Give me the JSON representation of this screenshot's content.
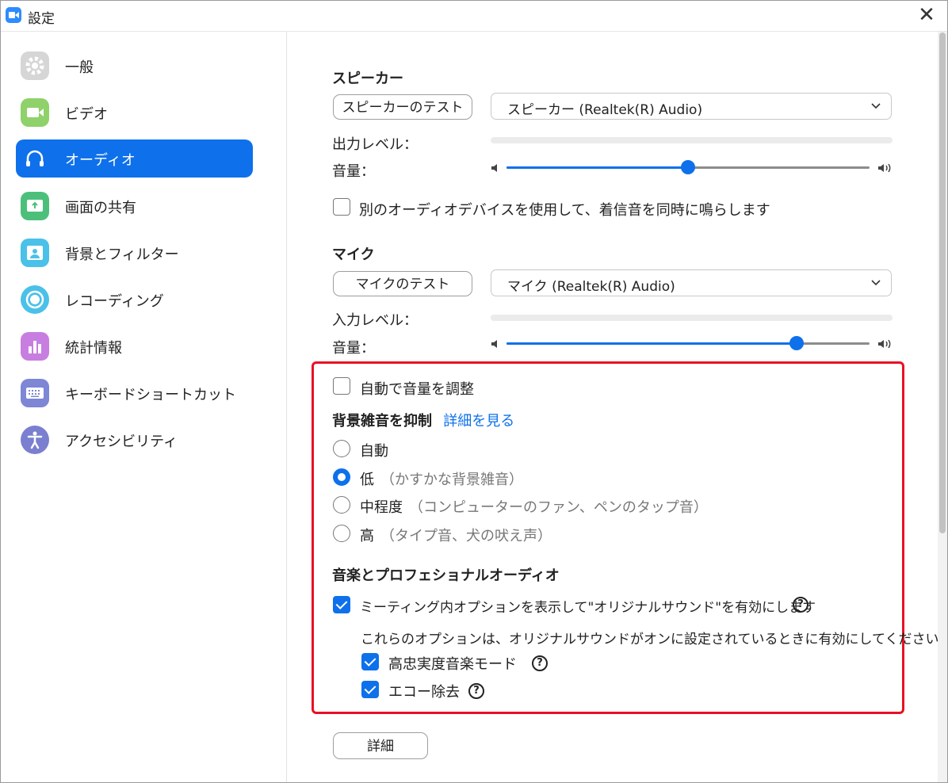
{
  "window": {
    "title": "設定"
  },
  "sidebar": {
    "items": [
      {
        "label": "一般",
        "icon": "gear-icon"
      },
      {
        "label": "ビデオ",
        "icon": "video-camera-icon"
      },
      {
        "label": "オーディオ",
        "icon": "headphones-icon",
        "active": true
      },
      {
        "label": "画面の共有",
        "icon": "screen-share-icon"
      },
      {
        "label": "背景とフィルター",
        "icon": "background-person-icon"
      },
      {
        "label": "レコーディング",
        "icon": "record-icon"
      },
      {
        "label": "統計情報",
        "icon": "bar-chart-icon"
      },
      {
        "label": "キーボードショートカット",
        "icon": "keyboard-icon"
      },
      {
        "label": "アクセシビリティ",
        "icon": "accessibility-icon"
      }
    ]
  },
  "speaker": {
    "heading": "スピーカー",
    "test_button": "スピーカーのテスト",
    "device": "スピーカー (Realtek(R) Audio)",
    "output_level_label": "出力レベル：",
    "volume_label": "音量：",
    "volume": 0.5
  },
  "separate_device": {
    "label": "別のオーディオデバイスを使用して、着信音を同時に鳴らします",
    "checked": false
  },
  "mic": {
    "heading": "マイク",
    "test_button": "マイクのテスト",
    "device": "マイク (Realtek(R) Audio)",
    "input_level_label": "入力レベル：",
    "volume_label": "音量：",
    "volume": 0.8
  },
  "auto_adjust": {
    "label": "自動で音量を調整",
    "checked": false
  },
  "noise": {
    "heading": "背景雑音を抑制",
    "details_link": "詳細を見る",
    "options": [
      {
        "label": "自動",
        "note": "",
        "selected": false
      },
      {
        "label": "低",
        "note": "（かすかな背景雑音）",
        "selected": true
      },
      {
        "label": "中程度",
        "note": "（コンピューターのファン、ペンのタップ音）",
        "selected": false
      },
      {
        "label": "高",
        "note": "（タイプ音、犬の吠え声）",
        "selected": false
      }
    ]
  },
  "music": {
    "heading": "音楽とプロフェショナルオーディオ",
    "original_sound": {
      "label": "ミーティング内オプションを表示して\"オリジナルサウンド\"を有効にします",
      "checked": true
    },
    "hint": "これらのオプションは、オリジナルサウンドがオンに設定されているときに有効にしてください",
    "hifi": {
      "label": "高忠実度音楽モード",
      "checked": true
    },
    "echo": {
      "label": "エコー除去",
      "checked": true
    }
  },
  "advanced_button": "詳細",
  "colors": {
    "accent": "#0e71eb",
    "highlight": "#e81123"
  }
}
